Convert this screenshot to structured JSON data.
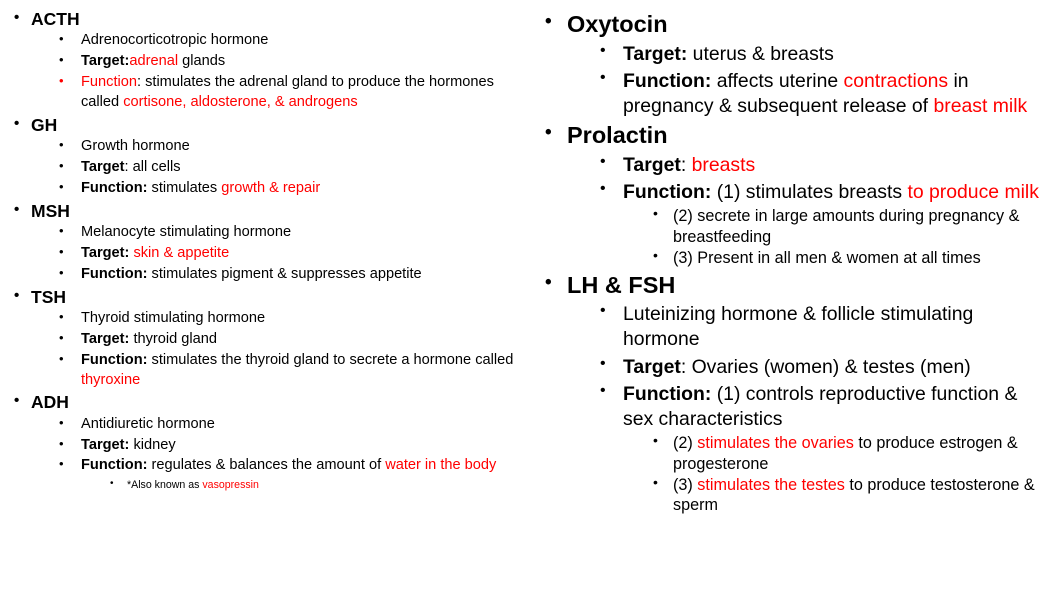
{
  "colors": {
    "accent_red": "#FF0000",
    "text_black": "#000000",
    "background": "#FFFFFF"
  },
  "bullets": {
    "glyph": "•"
  },
  "left_column": {
    "sections": [
      {
        "heading": "ACTH",
        "lines": [
          {
            "label": "",
            "text": "Adrenocorticotropic hormone"
          },
          {
            "label": "Target:",
            "label_bold": true,
            "text_pre": "",
            "text_red": "adrenal",
            "text_post": " glands"
          },
          {
            "label": "Function",
            "label_red": true,
            "text_pre": ": stimulates the adrenal gland to produce the hormones called ",
            "text_red": "cortisone, aldosterone, & androgens",
            "text_post": ""
          }
        ]
      },
      {
        "heading": "GH",
        "lines": [
          {
            "label": "",
            "text": "Growth hormone"
          },
          {
            "label": "Target",
            "label_bold": true,
            "text_pre": ": all cells",
            "text_red": "",
            "text_post": ""
          },
          {
            "label": "Function:",
            "label_bold": true,
            "text_pre": " stimulates ",
            "text_red": "growth & repair",
            "text_post": ""
          }
        ]
      },
      {
        "heading": "MSH",
        "lines": [
          {
            "label": "",
            "text": "Melanocyte stimulating hormone"
          },
          {
            "label": "Target:",
            "label_bold": true,
            "text_pre": " ",
            "text_red": "skin & appetite",
            "text_post": ""
          },
          {
            "label": "Function:",
            "label_bold": true,
            "text_pre": " stimulates pigment & suppresses appetite",
            "text_red": "",
            "text_post": ""
          }
        ]
      },
      {
        "heading": "TSH",
        "lines": [
          {
            "label": "",
            "text": "Thyroid stimulating hormone"
          },
          {
            "label": "Target:",
            "label_bold": true,
            "text_pre": " thyroid gland",
            "text_red": "",
            "text_post": ""
          },
          {
            "label": "Function:",
            "label_bold": true,
            "text_pre": " stimulates the thyroid gland to secrete a hormone called ",
            "text_red": "thyroxine",
            "text_post": ""
          }
        ]
      },
      {
        "heading": "ADH",
        "lines": [
          {
            "label": "",
            "text": "Antidiuretic hormone"
          },
          {
            "label": "Target:",
            "label_bold": true,
            "text_pre": " kidney",
            "text_red": "",
            "text_post": ""
          },
          {
            "label": "Function:",
            "label_bold": true,
            "text_pre": " regulates & balances the amount of ",
            "text_red": "water in the body",
            "text_post": ""
          }
        ],
        "subnote": {
          "text_pre": "*Also known as ",
          "text_red": "vasopressin"
        }
      }
    ]
  },
  "right_column": {
    "sections": [
      {
        "heading": "Oxytocin",
        "lines": [
          {
            "label": "Target:",
            "label_bold": true,
            "text_pre": " uterus & breasts",
            "text_red": "",
            "text_post": ""
          },
          {
            "label": "Function:",
            "label_bold": true,
            "text_pre": " affects uterine ",
            "text_red": "contractions",
            "text_post": " in pregnancy & subsequent release of ",
            "text_red2": "breast milk"
          }
        ]
      },
      {
        "heading": "Prolactin",
        "lines": [
          {
            "label": "Target",
            "label_bold": true,
            "text_pre": ": ",
            "text_red": "breasts",
            "text_post": ""
          },
          {
            "label": "Function:",
            "label_bold": true,
            "text_pre": " (1) stimulates breasts ",
            "text_red": "to produce milk",
            "text_post": ""
          }
        ],
        "sublines": [
          {
            "text": "(2) secrete in large amounts during pregnancy & breastfeeding"
          },
          {
            "text": "(3) Present in all men & women at all times"
          }
        ]
      },
      {
        "heading": "LH & FSH",
        "lines": [
          {
            "label": "",
            "text": "Luteinizing hormone & follicle stimulating hormone"
          },
          {
            "label": "Target",
            "label_bold": true,
            "text_pre": ": Ovaries (women) & testes (men)",
            "text_red": "",
            "text_post": ""
          },
          {
            "label": "Function:",
            "label_bold": true,
            "text_pre": " (1) controls reproductive function & sex characteristics",
            "text_red": "",
            "text_post": ""
          }
        ],
        "sublines": [
          {
            "text_pre": "(2) ",
            "text_red": "stimulates the ovaries",
            "text_post": " to produce estrogen & progesterone"
          },
          {
            "text_pre": "(3) ",
            "text_red": "stimulates the testes",
            "text_post": " to produce testosterone & sperm"
          }
        ]
      }
    ]
  }
}
